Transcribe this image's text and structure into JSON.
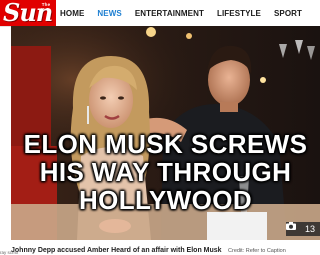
{
  "header": {
    "logo_small": "The U.S.",
    "logo_text": "Sun",
    "nav": [
      {
        "label": "HOME",
        "active": false
      },
      {
        "label": "NEWS",
        "active": true
      },
      {
        "label": "ENTERTAINMENT",
        "active": false
      },
      {
        "label": "LIFESTYLE",
        "active": false
      },
      {
        "label": "SPORT",
        "active": false
      }
    ]
  },
  "hero": {
    "headline_lines": [
      "ELON MUSK SCREWS",
      "HIS WAY THROUGH",
      "HOLLYWOOD"
    ],
    "photo_count": "13"
  },
  "caption": {
    "text": "Johnny Depp accused Amber Heard of an affair with Elon Musk",
    "credit": "Credit: Refer to Caption"
  },
  "cut_text": "ray scrnx",
  "colors": {
    "brand_red": "#e10000",
    "nav_active": "#1e7fd1",
    "nav_text": "#1a1a1a"
  },
  "icons": {
    "camera": "camera-icon"
  }
}
